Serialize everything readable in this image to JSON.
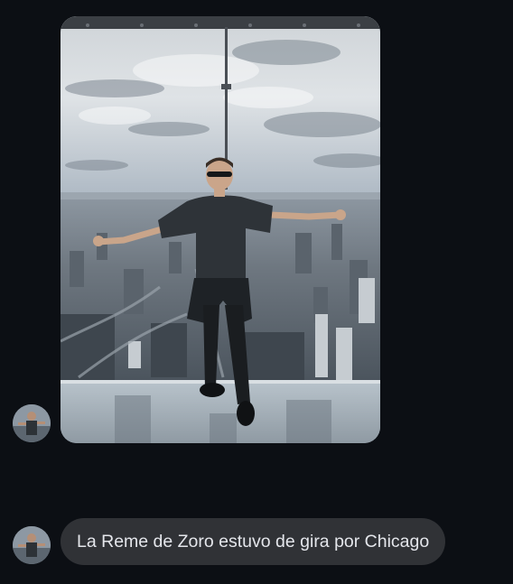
{
  "conversation": {
    "messages": [
      {
        "type": "photo",
        "photo_subject": "man-on-glass-skydeck-over-city"
      },
      {
        "type": "text",
        "text": "La Reme de Zoro estuvo de gira por Chicago"
      }
    ]
  },
  "colors": {
    "background": "#0c0f14",
    "bubble": "#303236",
    "bubble_text": "#e4e6eb"
  }
}
